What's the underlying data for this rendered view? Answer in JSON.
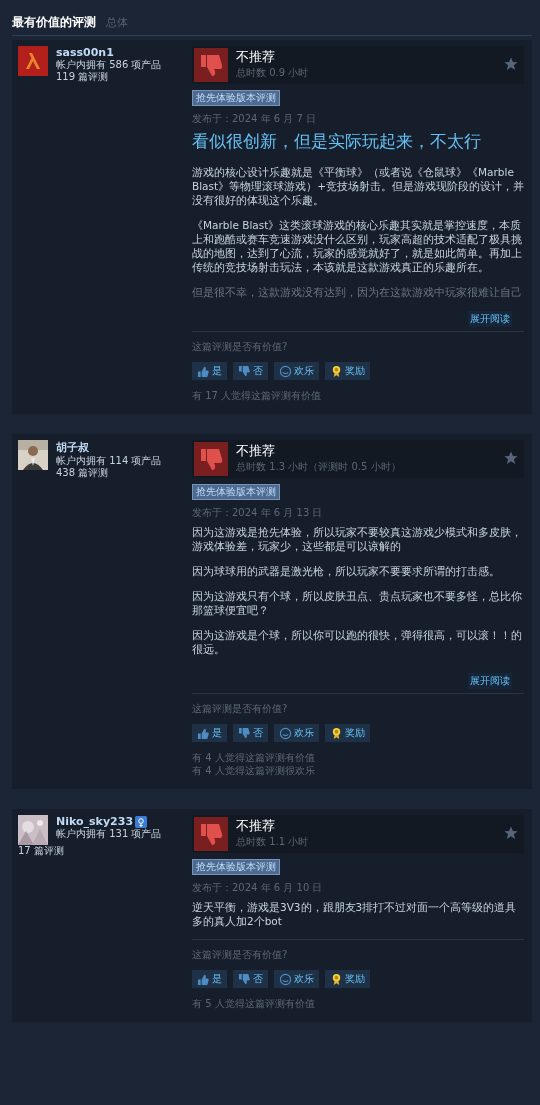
{
  "header": {
    "title": "最有价值的评测",
    "tab": "总体"
  },
  "reviews": [
    {
      "author": {
        "name": "sass00n1",
        "products": "帐户内拥有 586 项产品",
        "reviews": "119 篇评测",
        "pronoun_icon": false
      },
      "recommended": false,
      "verdict": "不推荐",
      "hours": "总时数 0.9 小时",
      "badge": "抢先体验版本评测",
      "date": "发布于：2024 年 6 月 7 日",
      "title": "看似很创新，但是实际玩起来，不太行",
      "paragraphs": [
        "游戏的核心设计乐趣就是《平衡球》（或者说《仓鼠球》《Marble Blast》等物理滚球游戏）+竞技场射击。但是游戏现阶段的设计，并没有很好的体现这个乐趣。",
        "《Marble Blast》这类滚球游戏的核心乐趣其实就是掌控速度，本质上和跑酷或赛车竞速游戏没什么区别，玩家高超的技术适配了极具挑战的地图，达到了心流，玩家的感觉就好了，就是如此简单。再加上传统的竞技场射击玩法，本该就是这款游戏真正的乐趣所在。",
        "但是很不幸，这款游戏没有达到，因为在这款游戏中玩家很难让自己"
      ],
      "fade_last": true,
      "read_more": "展开阅读",
      "helpful_prompt": "这篇评测是否有价值?",
      "actions": [
        {
          "kind": "yes",
          "label": "是"
        },
        {
          "kind": "no",
          "label": "否"
        },
        {
          "kind": "funny",
          "label": "欢乐"
        },
        {
          "kind": "award",
          "label": "奖励"
        }
      ],
      "tallies": [
        "有 17 人觉得这篇评测有价值"
      ]
    },
    {
      "author": {
        "name": "胡子叔",
        "products": "帐户内拥有 114 项产品",
        "reviews": "438 篇评测",
        "pronoun_icon": false
      },
      "recommended": false,
      "verdict": "不推荐",
      "hours": "总时数 1.3 小时（评测时 0.5 小时）",
      "badge": "抢先体验版本评测",
      "date": "发布于：2024 年 6 月 13 日",
      "paragraphs": [
        "因为这游戏是抢先体验，所以玩家不要较真这游戏少模式和多皮肤，游戏体验差，玩家少，这些都是可以谅解的",
        "因为球球用的武器是激光枪，所以玩家不要要求所谓的打击感。",
        "因为这游戏只有个球，所以皮肤丑点、贵点玩家也不要多怪，总比你那篮球便宜吧？",
        "因为这游戏是个球，所以你可以跑的很快，弹得很高，可以滚！！的很远。"
      ],
      "fade_last": false,
      "read_more": "展开阅读",
      "helpful_prompt": "这篇评测是否有价值?",
      "actions": [
        {
          "kind": "yes",
          "label": "是"
        },
        {
          "kind": "no",
          "label": "否"
        },
        {
          "kind": "funny",
          "label": "欢乐"
        },
        {
          "kind": "award",
          "label": "奖励"
        }
      ],
      "tallies": [
        "有 4 人觉得这篇评测有价值",
        "有 4 人觉得这篇评测很欢乐"
      ]
    },
    {
      "author": {
        "name": "Niko_sky233",
        "products": "帐户内拥有 131 项产品",
        "reviews": "17 篇评测",
        "pronoun_icon": true
      },
      "recommended": false,
      "verdict": "不推荐",
      "hours": "总时数 1.1 小时",
      "badge": "抢先体验版本评测",
      "date": "发布于：2024 年 6 月 10 日",
      "paragraphs": [
        "逆天平衡，游戏是3V3的，跟朋友3排打不过对面一个高等级的道具多的真人加2个bot"
      ],
      "fade_last": false,
      "helpful_prompt": "这篇评测是否有价值?",
      "actions": [
        {
          "kind": "yes",
          "label": "是"
        },
        {
          "kind": "no",
          "label": "否"
        },
        {
          "kind": "funny",
          "label": "欢乐"
        },
        {
          "kind": "award",
          "label": "奖励"
        }
      ],
      "tallies": [
        "有 5 人觉得这篇评测有价值"
      ]
    }
  ]
}
